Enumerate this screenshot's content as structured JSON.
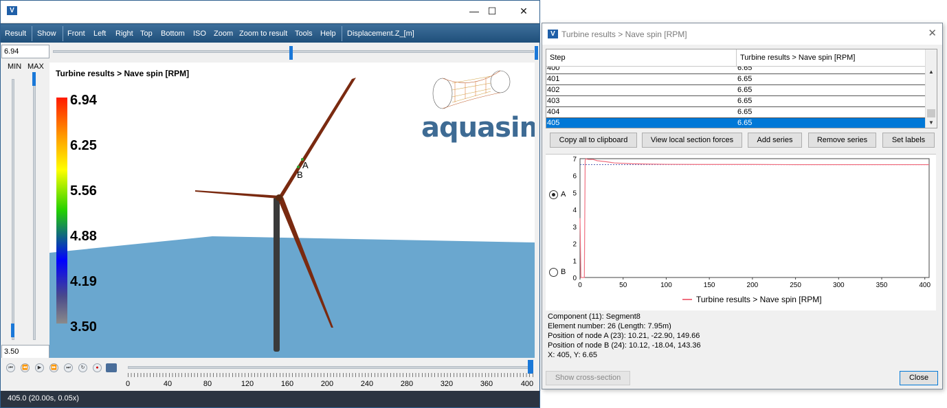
{
  "main": {
    "window_controls": {
      "minimize": "—",
      "maximize": "☐",
      "close": "✕"
    },
    "menu": [
      "Result",
      "Show",
      "Front",
      "Left",
      "Right",
      "Top",
      "Bottom",
      "ISO",
      "Zoom",
      "Zoom to result",
      "Tools",
      "Help",
      "Displacement.Z_[m]"
    ],
    "top_value": "6.94",
    "bottom_value": "3.50",
    "min_label": "MIN",
    "max_label": "MAX",
    "viewport_title": "Turbine results > Nave spin [RPM]",
    "colorbar_labels": [
      "6.94",
      "6.25",
      "5.56",
      "4.88",
      "4.19",
      "3.50"
    ],
    "colorbar_colors": [
      "#ff1a00",
      "#ff9a00",
      "#ffff00",
      "#22d000",
      "#0000ff",
      "#8a8a8a"
    ],
    "logo_text": "aquasim",
    "node_a": "A",
    "node_b": "B",
    "sea_color": "#6aa7cf",
    "blade_color": "#7a2a10",
    "tower_color": "#3a3a3a",
    "timeline_ticks": [
      "0",
      "40",
      "80",
      "120",
      "160",
      "200",
      "240",
      "280",
      "320",
      "360",
      "400"
    ],
    "timeline_progress": 1.0,
    "playback_icons": [
      "first-frame-icon",
      "rewind-icon",
      "play-icon",
      "fast-forward-icon",
      "last-frame-icon",
      "loop-icon",
      "record-icon",
      "camera-icon"
    ],
    "status": "405.0 (20.00s, 0.05x)"
  },
  "dialog": {
    "title": "Turbine results > Nave spin [RPM]",
    "close_glyph": "✕",
    "columns": [
      "Step",
      "Turbine results > Nave spin [RPM]"
    ],
    "rows": [
      [
        "400",
        "6.65"
      ],
      [
        "401",
        "6.65"
      ],
      [
        "402",
        "6.65"
      ],
      [
        "403",
        "6.65"
      ],
      [
        "404",
        "6.65"
      ],
      [
        "405",
        "6.65"
      ]
    ],
    "buttons": [
      "Copy all to clipboard",
      "View local section forces",
      "Add series",
      "Remove series",
      "Set labels"
    ],
    "radio_a": "A",
    "radio_b": "B",
    "legend": "Turbine results > Nave spin [RPM]",
    "info": [
      "Component (11): Segment8",
      "Element number: 26 (Length: 7.95m)",
      "Position of node A (23): 10.21, -22.90, 149.66",
      "Position of node B (24): 10.12, -18.04, 143.36",
      "X: 405, Y: 6.65"
    ],
    "show_cross_section": "Show cross-section",
    "close_button": "Close"
  },
  "chart_data": {
    "type": "line",
    "xlim": [
      0,
      405
    ],
    "ylim": [
      0,
      7
    ],
    "x_ticks": [
      "0",
      "50",
      "100",
      "150",
      "200",
      "250",
      "300",
      "350",
      "400"
    ],
    "y_ticks": [
      "0",
      "1",
      "2",
      "3",
      "4",
      "5",
      "6",
      "7"
    ],
    "series": [
      {
        "name": "Turbine results > Nave spin [RPM]",
        "color": "#f07080",
        "x": [
          0,
          1,
          2,
          3,
          4,
          5,
          6,
          7,
          8,
          10,
          15,
          20,
          30,
          40,
          60,
          80,
          100,
          150,
          200,
          250,
          300,
          350,
          405
        ],
        "y": [
          3.5,
          0,
          0,
          0,
          0,
          0,
          6.9,
          7.0,
          6.97,
          6.95,
          6.96,
          6.88,
          6.82,
          6.75,
          6.7,
          6.68,
          6.67,
          6.66,
          6.66,
          6.65,
          6.65,
          6.65,
          6.65
        ]
      }
    ],
    "reference_line": {
      "y": 6.65,
      "style": "dashed",
      "color": "#4a5ab0"
    }
  }
}
